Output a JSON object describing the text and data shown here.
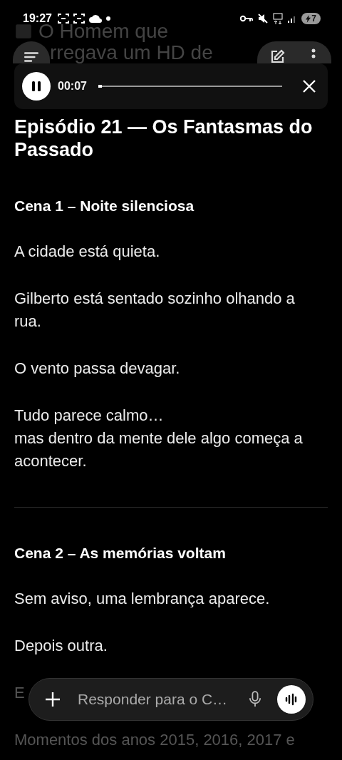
{
  "status_bar": {
    "time": "19:27",
    "battery": "7"
  },
  "header": {
    "title_lines": [
      "O Homem que",
      "rregava um HD de"
    ]
  },
  "player": {
    "playing": true,
    "elapsed": "00:07",
    "level": 0.02
  },
  "article": {
    "title": "Episódio 21 — Os Fantasmas do Passado",
    "blocks": [
      {
        "kind": "heading",
        "text": "Cena 1 – Noite silenciosa"
      },
      {
        "kind": "paragraph",
        "text": "A cidade está quieta."
      },
      {
        "kind": "paragraph",
        "text": "Gilberto está sentado sozinho olhando a rua."
      },
      {
        "kind": "paragraph",
        "text": "O vento passa devagar."
      },
      {
        "kind": "paragraph",
        "text": "Tudo parece calmo…\nmas dentro da mente dele algo começa a acontecer."
      },
      {
        "kind": "divider"
      },
      {
        "kind": "heading",
        "text": "Cena 2 – As memórias voltam"
      },
      {
        "kind": "paragraph",
        "text": "Sem aviso, uma lembrança aparece."
      },
      {
        "kind": "paragraph",
        "text": "Depois outra."
      },
      {
        "kind": "faded",
        "text": "E"
      },
      {
        "kind": "faded",
        "text": "Momentos dos anos 2015, 2016, 2017 e"
      }
    ]
  },
  "composer": {
    "placeholder": "Responder para o C…"
  }
}
